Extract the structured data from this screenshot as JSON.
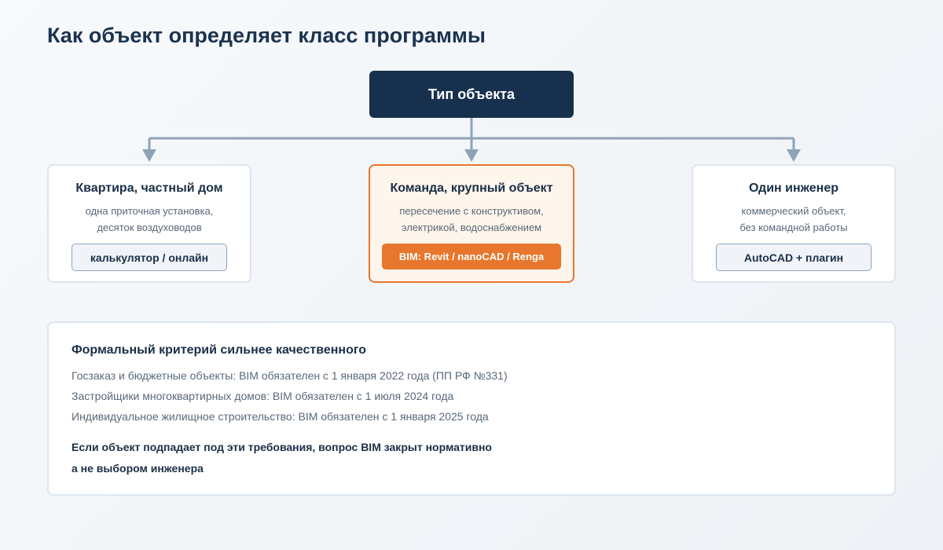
{
  "title": "Как объект определяет класс программы",
  "root": {
    "label": "Тип объекта"
  },
  "cards": [
    {
      "title": "Квартира, частный дом",
      "desc_lines": [
        "одна приточная установка,",
        "десяток воздуховодов"
      ],
      "tag": "калькулятор / онлайн"
    },
    {
      "title": "Команда, крупный объект",
      "desc_lines": [
        "пересечение с конструктивом,",
        "электрикой, водоснабжением"
      ],
      "tag": "BIM: Revit / nanoCAD / Renga"
    },
    {
      "title": "Один инженер",
      "desc_lines": [
        "коммерческий объект,",
        "без командной работы"
      ],
      "tag": "AutoCAD + плагин"
    }
  ],
  "criteria": {
    "title": "Формальный критерий сильнее качественного",
    "items": [
      "Госзаказ и бюджетные объекты: BIM обязателен с 1 января 2022 года (ПП РФ №331)",
      "Застройщики многоквартирных домов: BIM обязателен с 1 июля 2024 года",
      "Индивидуальное жилищное строительство: BIM обязателен с 1 января 2025 года"
    ],
    "note_lines": [
      "Если объект подпадает под эти требования, вопрос BIM закрыт нормативно",
      "а не выбором инженера"
    ]
  },
  "colors": {
    "root_bg": "#17304d",
    "accent": "#e8762c",
    "connector": "#8ea3b8"
  }
}
